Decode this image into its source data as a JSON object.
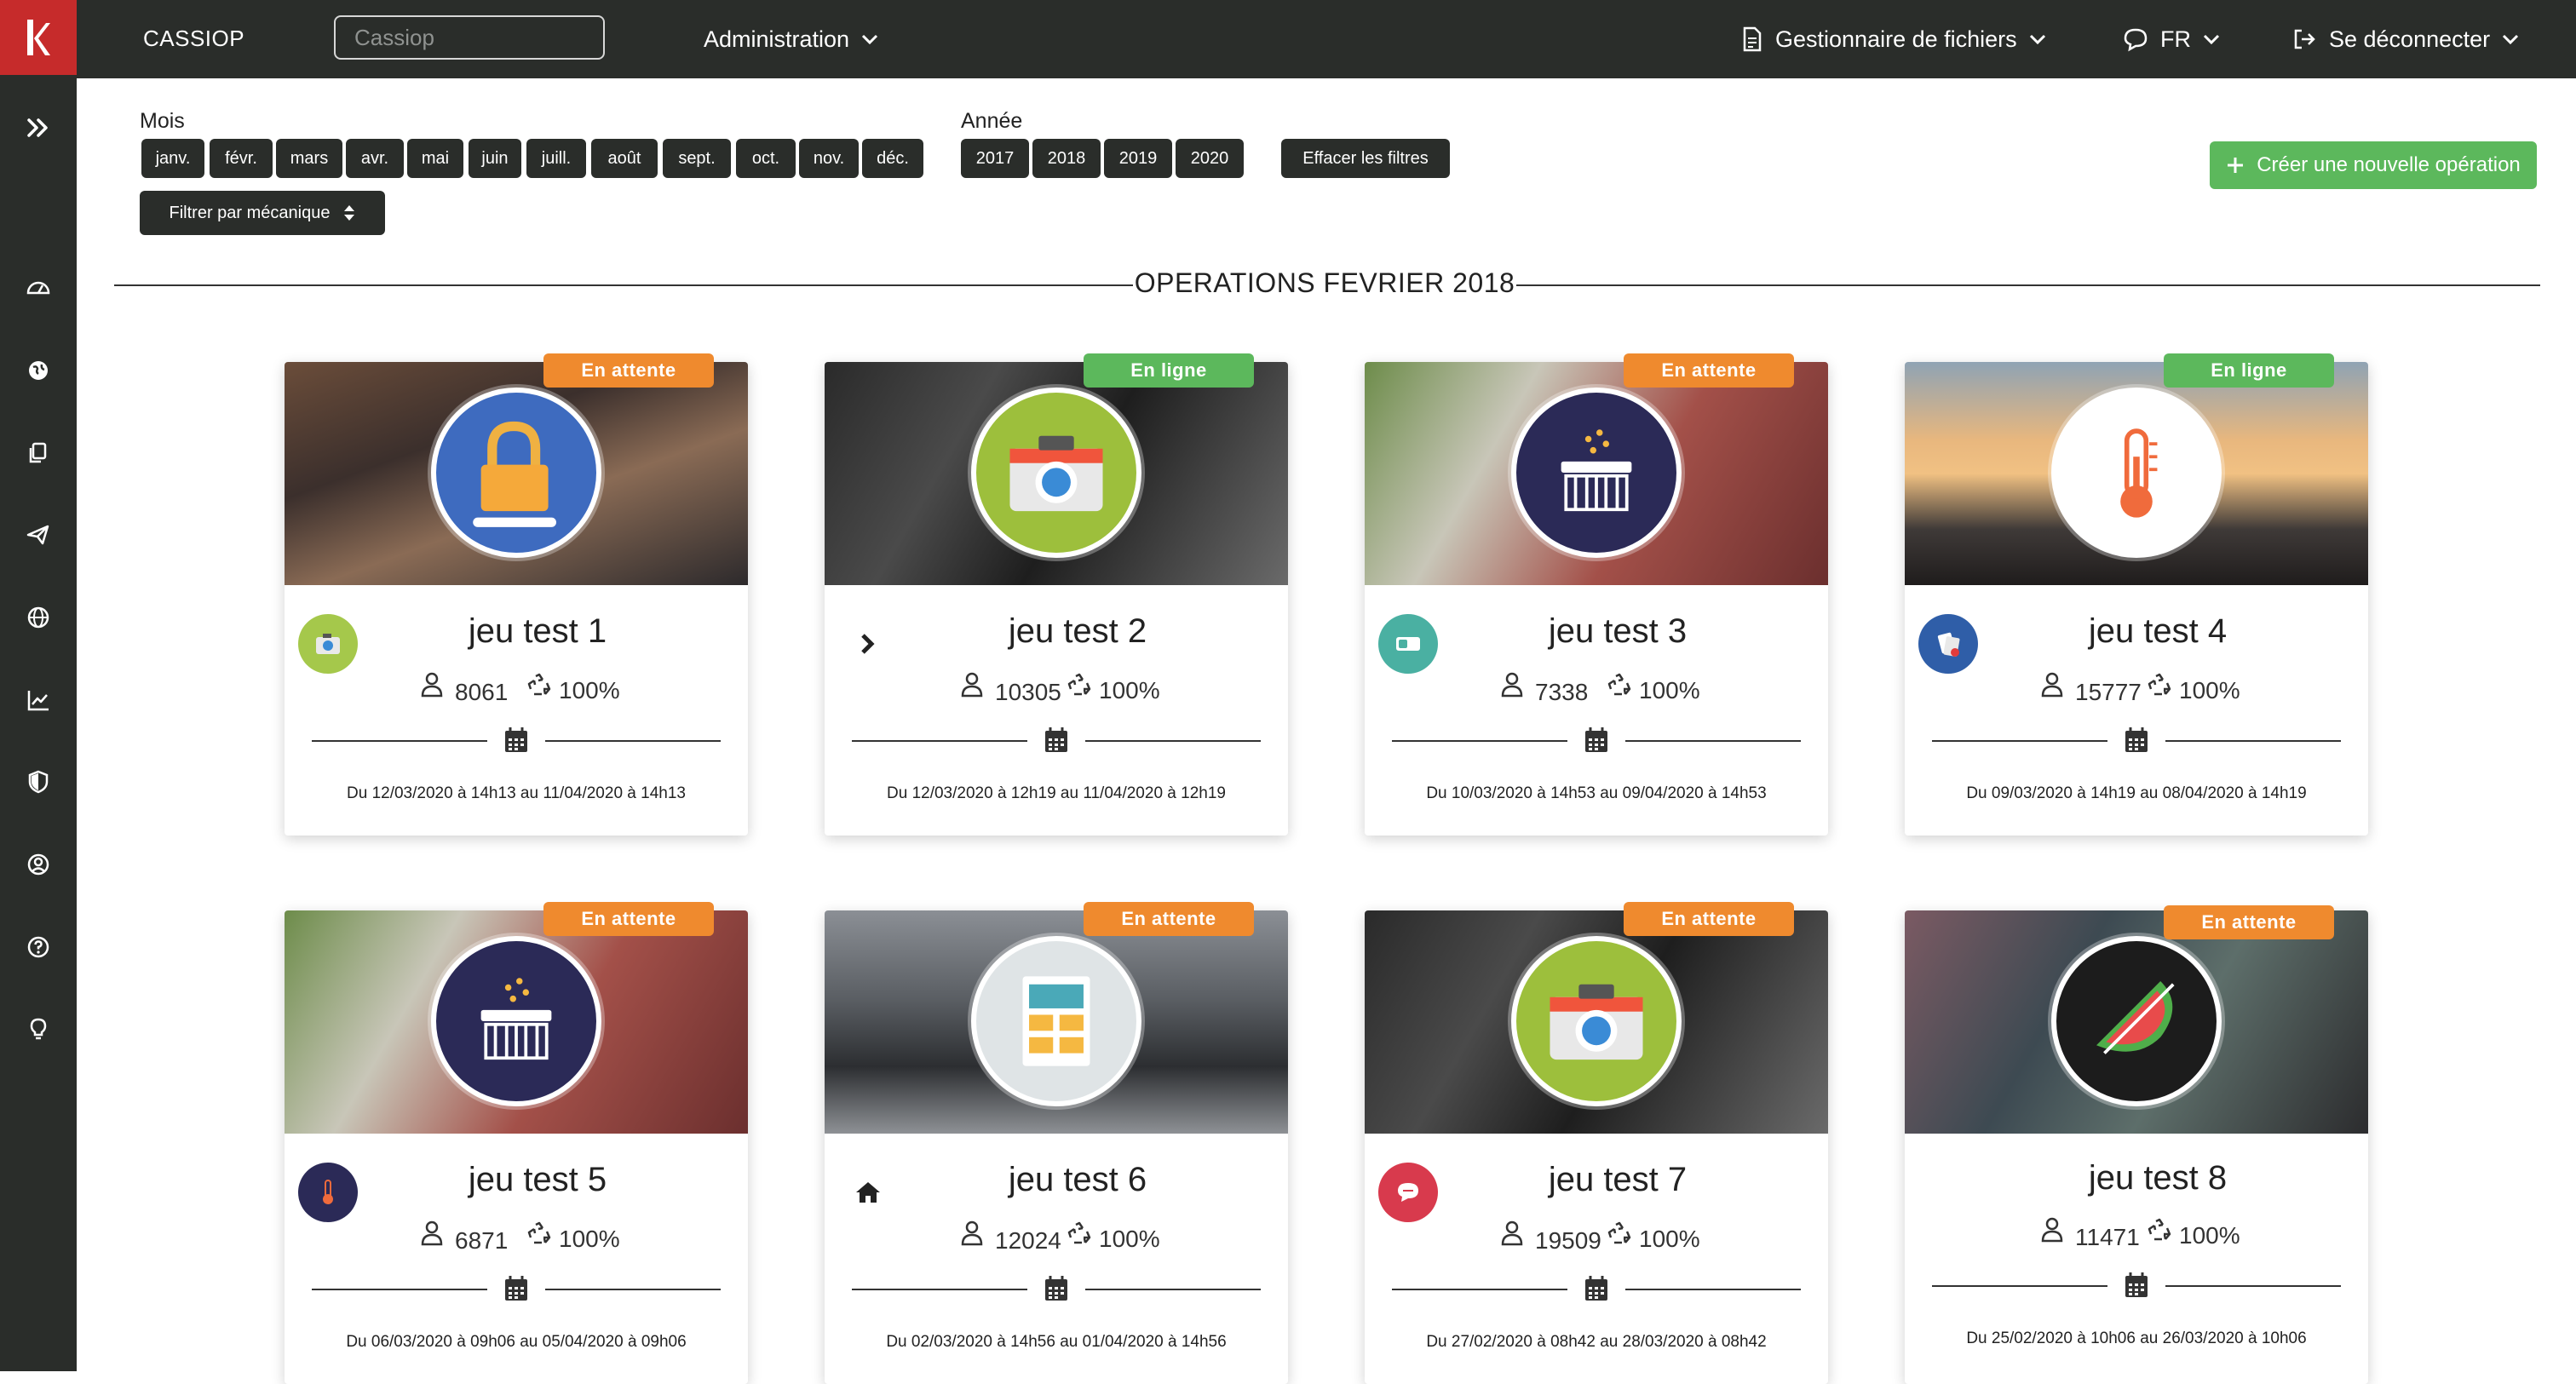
{
  "app": {
    "brand": "CASSIOP"
  },
  "topbar": {
    "search_placeholder": "Cassiop",
    "admin_label": "Administration",
    "files_label": "Gestionnaire de fichiers",
    "lang_label": "FR",
    "logout_label": "Se déconnecter"
  },
  "sidebar": {
    "icons": [
      "expand-icon",
      "dashboard-icon",
      "globe-icon",
      "copy-icon",
      "send-icon",
      "world-icon",
      "chart-icon",
      "shield-icon",
      "user-icon",
      "help-icon",
      "lightbulb-icon"
    ]
  },
  "filters": {
    "months_label": "Mois",
    "months": [
      "janv.",
      "févr.",
      "mars",
      "avr.",
      "mai",
      "juin",
      "juill.",
      "août",
      "sept.",
      "oct.",
      "nov.",
      "déc."
    ],
    "years_label": "Année",
    "years": [
      "2017",
      "2018",
      "2019",
      "2020"
    ],
    "clear_label": "Effacer les filtres",
    "mechanic_label": "Filtrer par mécanique",
    "create_label": "Créer une nouvelle opération"
  },
  "section_title": "OPERATIONS FEVRIER 2018",
  "operations": [
    {
      "title": "jeu test 1",
      "participants": "8061",
      "percent": "100%",
      "dates": "Du 12/03/2020 à 14h13 au 11/04/2020 à 14h13",
      "status": "En attente",
      "icon": "padlock-icon",
      "mini": "camera-mini-icon"
    },
    {
      "title": "jeu test 2",
      "participants": "10305",
      "percent": "100%",
      "dates": "Du 12/03/2020 à 12h19 au 11/04/2020 à 12h19",
      "status": "En ligne",
      "icon": "camera-icon",
      "mini": "chevron-right-icon"
    },
    {
      "title": "jeu test 3",
      "participants": "7338",
      "percent": "100%",
      "dates": "Du 10/03/2020 à 14h53 au 09/04/2020 à 14h53",
      "status": "En attente",
      "icon": "basket-icon",
      "mini": "toggle-mini-icon"
    },
    {
      "title": "jeu test 4",
      "participants": "15777",
      "percent": "100%",
      "dates": "Du 09/03/2020 à 14h19 au 08/04/2020 à 14h19",
      "status": "En ligne",
      "icon": "thermometer-icon",
      "mini": "cards-mini-icon"
    },
    {
      "title": "jeu test 5",
      "participants": "6871",
      "percent": "100%",
      "dates": "Du 06/03/2020 à 09h06 au 05/04/2020 à 09h06",
      "status": "En attente",
      "icon": "basket-icon",
      "mini": "thermometer-mini-icon"
    },
    {
      "title": "jeu test 6",
      "participants": "12024",
      "percent": "100%",
      "dates": "Du 02/03/2020 à 14h56 au 01/04/2020 à 14h56",
      "status": "En attente",
      "icon": "layout-icon",
      "mini": "home-icon"
    },
    {
      "title": "jeu test 7",
      "participants": "19509",
      "percent": "100%",
      "dates": "Du 27/02/2020 à 08h42 au 28/03/2020 à 08h42",
      "status": "En attente",
      "icon": "camera-icon",
      "mini": "chat-mini-icon"
    },
    {
      "title": "jeu test 8",
      "participants": "11471",
      "percent": "100%",
      "dates": "Du 25/02/2020 à 10h06 au 26/03/2020 à 10h06",
      "status": "En attente",
      "icon": "watermelon-icon",
      "mini": ""
    }
  ],
  "colors": {
    "dark": "#2a2d2a",
    "brand_red": "#c62b2b",
    "pending": "#ef8a2e",
    "online": "#5cb85c"
  }
}
